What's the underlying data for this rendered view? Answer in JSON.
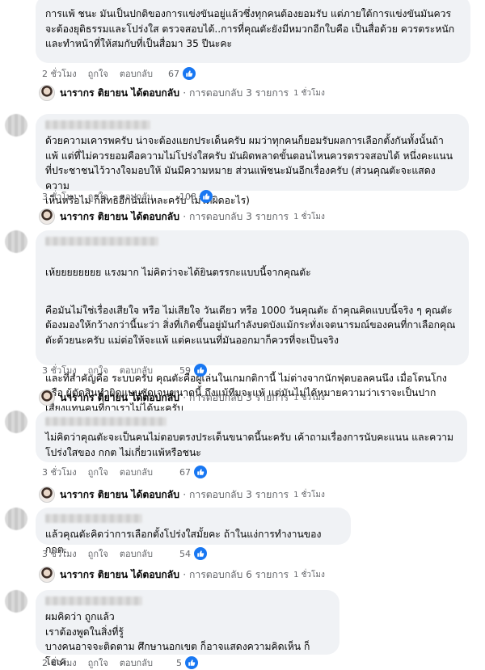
{
  "comments": [
    {
      "text": "การแพ้ ชนะ มันเป็นปกติของการแข่งขันอยู่แล้วซึ่งทุกคนต้องยอมรับ แต่ภายใต้การแข่งขันมันควร\nจะต้องยุติธรรมและโปร่งใส ตรวจสอบได้..การที่คุณตัะยังมีหมวกอีกใบคือ เป็นสื่อด้วย ควรตระหนัก\nและทำหน้าที่ให้สมกับที่เป็นสื่อมา 35 ปีนะคะ",
      "time": "2 ชั่วโมง",
      "like": "ถูกใจ",
      "reply": "ตอบกลับ",
      "reactions": "67",
      "replies": {
        "author": "นารากร ติยายน",
        "action": "ได้ตอบกลับ",
        "summary": "· การตอบกลับ 3 รายการ",
        "time": "1 ชั่วโมง"
      }
    },
    {
      "text": "ด้วยความเคารพครับ น่าจะต้องแยกประเด็นครับ ผมว่าทุกคนก็ยอมรับผลการเลือกตั้งกันทั้งนั้นถ้า\nแพ้ แต่ที่ไม่ควรยอมคือความไม่โปร่งใสครับ มันผิดพลาดขั้นตอนไหนควรตรวจสอบได้ หนึ่งคะแนน\nที่ประชาชนไว้วางใจมอบให้ มันมีความหมาย ส่วนแพ้ชนะมันอีกเรื่องครับ (ส่วนคุณตัะจะแสดงความ\nเห็นหรือไม่ ก็สิทธิอีกนั่นแหละครับ ไม่ได้ผิดอะไร)",
      "time": "3 ชั่วโมง",
      "like": "ถูกใจ",
      "reply": "ตอบกลับ",
      "reactions": "108",
      "replies": {
        "author": "นารากร ติยายน",
        "action": "ได้ตอบกลับ",
        "summary": "· การตอบกลับ 3 รายการ",
        "time": "1 ชั่วโมง"
      }
    },
    {
      "paragraphs": [
        "เห้ยยยยยยยย แรงมาก ไม่คิดว่าจะได้ยินตรรกะแบบนี้จากคุณตัะ",
        "คือมันไม่ใช่เรื่องเสียใจ หรือ ไม่เสียใจ วันเดียว หรือ 1000 วันคุณตัะ ถ้าคุณคิดแบบนี้จริง ๆ คุณตัะ\nต้องมองให้กว้างกว่านี้นะว่า สิ่งที่เกิดขึ้นอยู่มันกำลังบดบังแม้กระทั่งเจตนารมณ์ของคนที่กาเลือกคุณ\nตัะด้วยนะครับ แม่ต่อให้จะแพ้ แต่คะแนนที่มันออกมาก็ควรที่จะเป็นจริง",
        "และที่สำคัญคือ ระบบครับ คุณตัะคือผู้เล่นในเกมกติกานี้ ไม่ต่างจากนักฟุตบอลคนนึง เมื่อโดนโกง\nหรือ ผู้ตัดสินทำผิดแบบชัดเจนขนาดนี้ ถึงแม้ทีมจะแพ้ แต่มันไม่ได้หมายความว่าเราจะเป็นปาก\nเสียงแทนคนที่กาเราไม่ได้นะครับ"
      ],
      "time": "3 ชั่วโมง",
      "like": "ถูกใจ",
      "reply": "ตอบกลับ",
      "reactions": "59",
      "replies": {
        "author": "นารากร ติยายน",
        "action": "ได้ตอบกลับ",
        "summary": "· การตอบกลับ 3 รายการ",
        "time": "1 ชั่วโมง"
      }
    },
    {
      "text": "ไม่คิดว่าคุณตัะจะเป็นคนไม่ตอบตรงประเด็นขนาดนี้นะครับ เค้าถามเรื่องการนับคะแนน และความ\nโปร่งใสของ กกต ไม่เกี่ยวแพ้หรือชนะ",
      "time": "3 ชั่วโมง",
      "like": "ถูกใจ",
      "reply": "ตอบกลับ",
      "reactions": "67",
      "replies": {
        "author": "นารากร ติยายน",
        "action": "ได้ตอบกลับ",
        "summary": "· การตอบกลับ 3 รายการ",
        "time": "1 ชั่วโมง"
      }
    },
    {
      "text": "แล้วคุณตัะคิดว่าการเลือกตั้งโปร่งใสมั้ยคะ ถ้าในแง่การทำงานของ กกต.",
      "time": "3 ชั่วโมง",
      "like": "ถูกใจ",
      "reply": "ตอบกลับ",
      "reactions": "54",
      "replies": {
        "author": "นารากร ติยายน",
        "action": "ได้ตอบกลับ",
        "summary": "· การตอบกลับ 6 รายการ",
        "time": "1 ชั่วโมง"
      }
    },
    {
      "text": "ผมคิดว่า ถูกแล้ว\nเราต้องพูดในสิ่งที่รู้\nบางคนอาจจะติดตาม ศึกษานอกเขต ก็อาจแสดงความคิดเห็น ก็โอเค",
      "time": "2 ชั่วโมง",
      "like": "ถูกใจ",
      "reply": "ตอบกลับ",
      "reactions": "5"
    }
  ],
  "colors": {
    "bubble": "#f0f2f5",
    "like_blue": "#1877f2",
    "meta_gray": "#65676b"
  },
  "icons": {
    "reaction": "like-thumb-icon"
  }
}
